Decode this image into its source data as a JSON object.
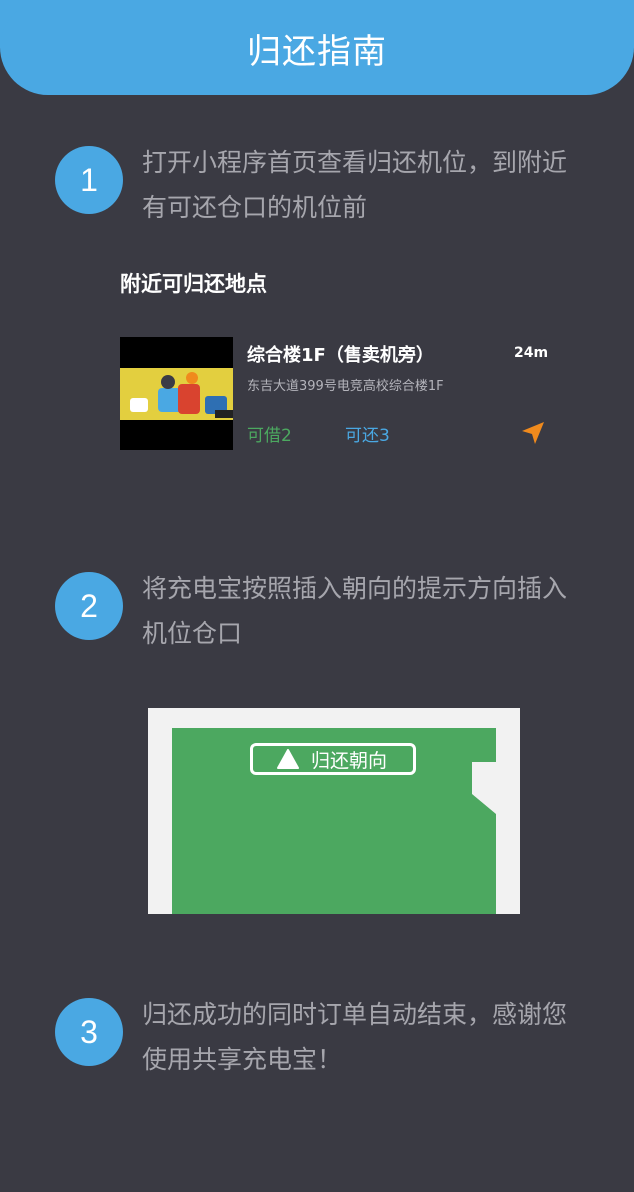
{
  "header": {
    "title": "归还指南"
  },
  "steps": [
    {
      "number": "1",
      "text": "打开小程序首页查看归还机位，到附近有可还仓口的机位前"
    },
    {
      "number": "2",
      "text": "将充电宝按照插入朝向的提示方向插入机位仓口"
    },
    {
      "number": "3",
      "text": "归还成功的同时订单自动结束，感谢您使用共享充电宝！"
    }
  ],
  "nearby": {
    "title": "附近可归还地点",
    "location": {
      "name": "综合楼1F（售卖机旁）",
      "distance": "24m",
      "address": "东吉大道399号电竞高校综合楼1F",
      "borrow_label": "可借2",
      "return_label": "可还3",
      "nav_icon": "navigation-arrow-icon"
    }
  },
  "diagram": {
    "orientation_label": "归还朝向",
    "arrow_icon": "up-triangle-icon"
  },
  "colors": {
    "accent": "#4aa8e3",
    "background": "#3a3a43",
    "green": "#4ca860",
    "orange": "#f08a1d"
  }
}
